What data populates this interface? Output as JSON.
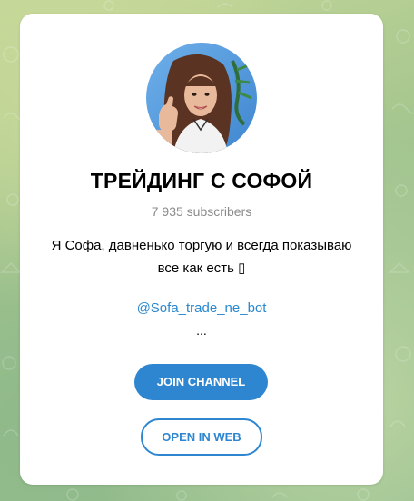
{
  "channel": {
    "title": "ТРЕЙДИНГ С СОФОЙ",
    "subscribers": "7 935 subscribers",
    "description_line1": "Я Софа, давненько торгую и всегда показываю",
    "description_line2": "все как есть ",
    "description_emoji": "▯",
    "link": "@Sofa_trade_ne_bot",
    "ellipsis": "..."
  },
  "buttons": {
    "join": "JOIN CHANNEL",
    "open_web": "OPEN IN WEB"
  },
  "colors": {
    "accent": "#2e86d0",
    "link": "#2a88cf",
    "muted_text": "#8b8b8b",
    "background": "#9fc18c"
  }
}
